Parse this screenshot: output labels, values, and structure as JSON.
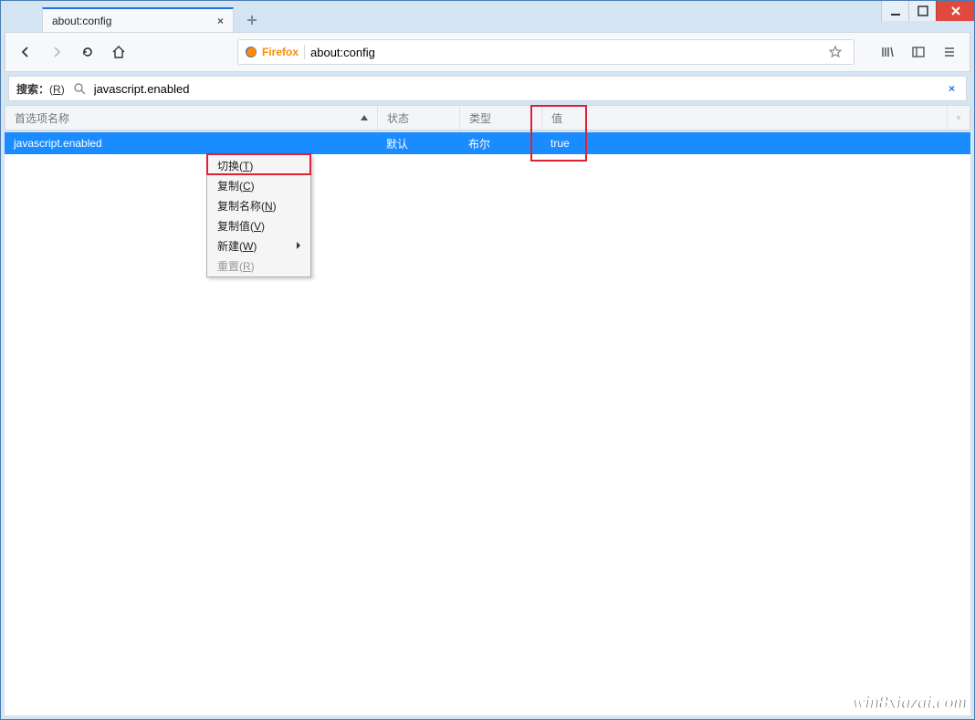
{
  "window": {
    "tab_title": "about:config",
    "watermark": "win8xiazai.com"
  },
  "toolbar": {
    "identity_label": "Firefox",
    "address_value": "about:config"
  },
  "search": {
    "label_text": "搜索：",
    "label_accelerator": "(R)",
    "input_value": "javascript.enabled"
  },
  "columns": {
    "name": "首选项名称",
    "status": "状态",
    "type": "类型",
    "value": "值"
  },
  "rows": [
    {
      "name": "javascript.enabled",
      "status": "默认",
      "type": "布尔",
      "value": "true"
    }
  ],
  "context_menu": {
    "toggle": "切换(T)",
    "copy": "复制(C)",
    "copy_name": "复制名称(N)",
    "copy_value": "复制值(V)",
    "new": "新建(W)",
    "reset": "重置(R)"
  }
}
